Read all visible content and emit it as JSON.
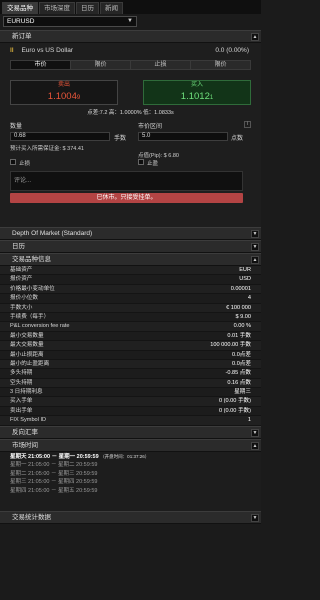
{
  "tabs": [
    "交易品种",
    "市场深度",
    "日历",
    "新闻"
  ],
  "symbol": "EURUSD",
  "new_order": {
    "header": "新订单",
    "instrument": "Euro vs US Dollar",
    "change": "0.0 (0.00%)",
    "order_tabs": [
      "市价",
      "限价",
      "止损",
      "限价"
    ],
    "sell_label": "卖出",
    "sell_price": "1.1004",
    "sell_pip": "9",
    "buy_label": "买入",
    "buy_price": "1.1012",
    "buy_pip": "1",
    "spread_line": "点差:7.2 高：1.0000%  低：1.0833s",
    "qty_label": "数量",
    "qty_value": "0.68",
    "qty_unit": "手数",
    "range_label": "市价区间",
    "range_value": "5.0",
    "range_unit": "点数",
    "margin_text": "预计买入所需保证金: $ 374.41",
    "pip_value_text": "点值(Pip): $ 6.80",
    "stop_loss": "止损",
    "take_profit": "止盈",
    "comment_placeholder": "评论...",
    "closed_notice": "已休市。只接受挂单。"
  },
  "sections": {
    "depth": "Depth Of Market (Standard)",
    "calendar": "日历",
    "instrument_info": "交易品种信息",
    "reverse_rate": "反向汇率",
    "market_hours": "市场时间",
    "instrument_stats": "交易统计数据"
  },
  "instrument_info": [
    {
      "k": "基础资产",
      "v": "EUR"
    },
    {
      "k": "报价资产",
      "v": "USD"
    },
    {
      "k": "价格最小变动单位",
      "v": "0.00001"
    },
    {
      "k": "报价小位数",
      "v": "4"
    },
    {
      "k": "手数大小",
      "v": "€ 100 000"
    },
    {
      "k": "手续费（每手）",
      "v": "$ 9.00"
    },
    {
      "k": "P&L conversion fee rate",
      "v": "0.00 %"
    },
    {
      "k": "最小交易数量",
      "v": "0.01 手数"
    },
    {
      "k": "最大交易数量",
      "v": "100 000.00 手数"
    },
    {
      "k": "最小止损距离",
      "v": "0.0点差"
    },
    {
      "k": "最小的止盈距离",
      "v": "0.0点差"
    },
    {
      "k": "多头持期",
      "v": "-0.85 点数"
    },
    {
      "k": "空头持期",
      "v": "0.16 点数"
    },
    {
      "k": "3 日持期利息",
      "v": "星期三"
    },
    {
      "k": "买入手单",
      "v": "0 (0.00 手数)"
    },
    {
      "k": "卖出手单",
      "v": "0 (0.00 手数)"
    },
    {
      "k": "FIX Symbol ID",
      "v": "1"
    }
  ],
  "market_hours": [
    {
      "text": "星期天 21:05:00 － 星期一 20:59:59",
      "badge": "（开盘时间：01:37:26）",
      "current": true
    },
    {
      "text": "星期一 21:05:00 － 星期二 20:59:59",
      "badge": "",
      "current": false
    },
    {
      "text": "星期二 21:05:00 － 星期三 20:59:59",
      "badge": "",
      "current": false
    },
    {
      "text": "星期三 21:05:00 － 星期四 20:59:59",
      "badge": "",
      "current": false
    },
    {
      "text": "星期四 21:05:00 － 星期五 20:59:59",
      "badge": "",
      "current": false
    }
  ]
}
